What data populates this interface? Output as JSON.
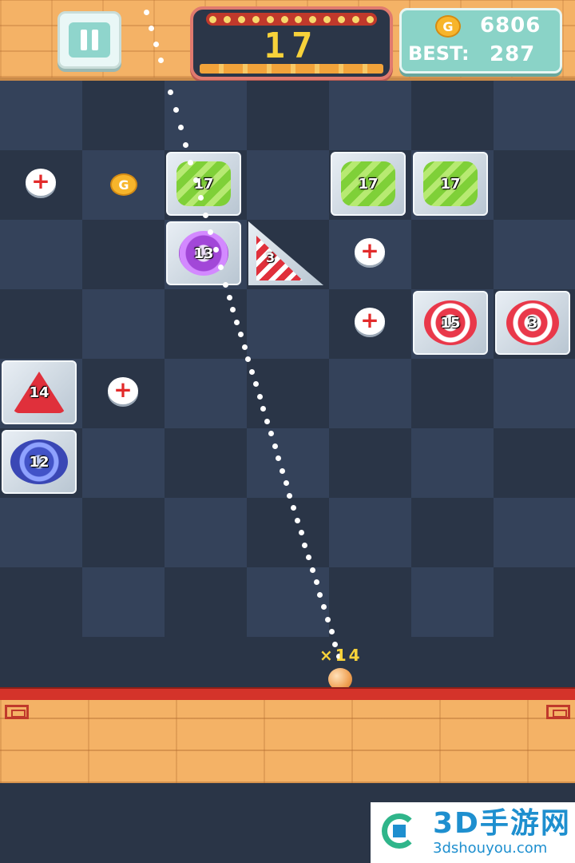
{
  "header": {
    "level": "17",
    "coins": "6806",
    "best_label": "BEST:",
    "best": "287",
    "coin_symbol": "G"
  },
  "board": {
    "blocks": [
      {
        "id": "green-17-a",
        "value": "17",
        "candy": "green-square"
      },
      {
        "id": "green-17-b",
        "value": "17",
        "candy": "green-square"
      },
      {
        "id": "green-17-c",
        "value": "17",
        "candy": "green-square"
      },
      {
        "id": "purple-13",
        "value": "13",
        "candy": "purple-swirl"
      },
      {
        "id": "tri-3",
        "value": "3",
        "candy": "red-striped-triangle"
      },
      {
        "id": "red-15",
        "value": "15",
        "candy": "red-swirl"
      },
      {
        "id": "red-3",
        "value": "3",
        "candy": "red-swirl"
      },
      {
        "id": "tri-14",
        "value": "14",
        "candy": "red-triangle"
      },
      {
        "id": "blue-12",
        "value": "12",
        "candy": "blue-swirl"
      }
    ],
    "pickups": {
      "plus_symbol": "+",
      "coin_symbol": "G"
    },
    "ball_count": "×14"
  },
  "watermark": {
    "main": "3D手游网",
    "sub": "3dshouyou.com"
  },
  "colors": {
    "board_dark": "#2a3547",
    "board_light": "#34425a",
    "accent_yellow": "#f7d23a",
    "floor": "#f4b266",
    "floor_line": "#d4332a"
  }
}
